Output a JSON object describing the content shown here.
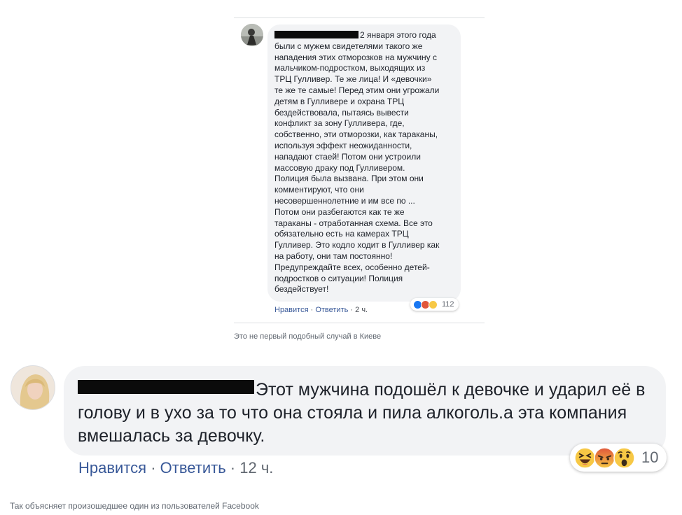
{
  "embedded_comment": {
    "text": "2 января этого года\nбыли с мужем свидетелями такого же\nнападения этих отморозков на мужчину с\nмальчиком-подростком, выходящих из\nТРЦ Гулливер. Те же лица! И «девочки»\nте же те самые! Перед этим они угрожали\nдетям в Гулливере и охрана ТРЦ\nбездействовала, пытаясь вывести\nконфликт за зону Гулливера, где,\nсобственно, эти отморозки, как тараканы,\nиспользуя эффект неожиданности,\nнападают стаей! Потом они устроили\nмассовую драку под Гулливером.\nПолиция была вызвана. При этом они\nкомментируют, что они\nнесовершеннолетние и им все по ...\nПотом они разбегаются как те же\nтараканы - отработанная схема. Все это\nобязательно есть на камерах ТРЦ\nГулливер. Это кодло ходит в Гулливер как\nна работу, они там постоянно!\nПредупреждайте всех, особенно детей-\nподростков о ситуации! Полиция\nбездействует!",
    "like_label": "Нравится",
    "reply_label": "Ответить",
    "time": "2 ч.",
    "reaction_icons": [
      "like-icon",
      "angry-icon",
      "wow-icon"
    ],
    "reaction_count": "112"
  },
  "caption_top": "Это не первый подобный случай в Киеве",
  "main_comment": {
    "text": "Этот мужчина подошёл к девочке и ударил её в голову и в ухо за то что она стояла и пила алкоголь.а эта компания вмешалась за девочку.",
    "like_label": "Нравится",
    "reply_label": "Ответить",
    "time": "12 ч.",
    "reaction_icons": [
      "haha-icon",
      "angry-icon",
      "wow-icon"
    ],
    "reaction_count": "10"
  },
  "caption_bottom": "Так объясняет произошедшее один из пользователей Facebook",
  "separator": " · ",
  "colors": {
    "bubble": "#f2f3f5",
    "link": "#385898",
    "meta": "#606770",
    "like_blue": "#1877f2",
    "angry_red": "#e0573b",
    "emoji_yellow": "#f7c845"
  }
}
